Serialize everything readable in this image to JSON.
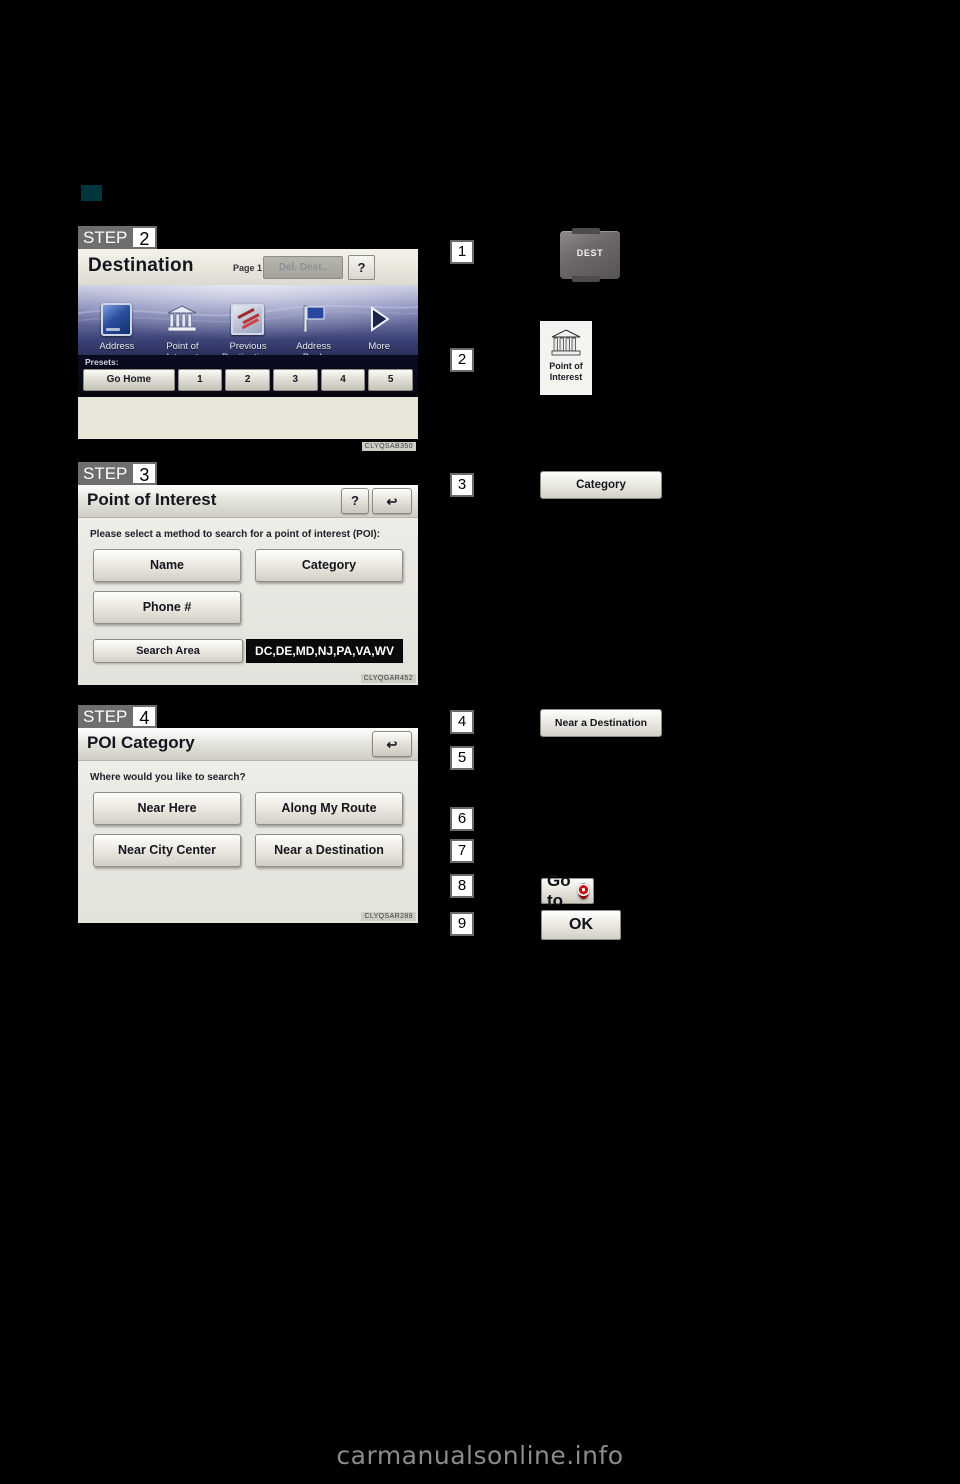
{
  "page": {
    "watermark": "carmanualsonline.info"
  },
  "steps": [
    {
      "badge_word": "STEP",
      "badge_num": "2",
      "screen": "destination",
      "title": "Destination",
      "page_label": "Page 1",
      "del_dest_label": "Del. Dest..",
      "help_label": "?",
      "icons": [
        {
          "label": "Address",
          "icon": "address-icon"
        },
        {
          "label": "Point of\nInterest",
          "line1": "Point of",
          "line2": "Interest",
          "icon": "point-of-interest-icon"
        },
        {
          "label": "Previous\nDestinations",
          "line1": "Previous",
          "line2": "Destinations",
          "icon": "previous-destinations-icon"
        },
        {
          "label": "Address\nBook",
          "line1": "Address",
          "line2": "Book",
          "icon": "address-book-flag-icon"
        },
        {
          "label": "More",
          "line1": "More",
          "line2": "",
          "icon": "more-arrow-icon"
        }
      ],
      "presets_label": "Presets:",
      "presets": [
        "Go Home",
        "1",
        "2",
        "3",
        "4",
        "5"
      ],
      "figure_code": "CLYQSAB350"
    },
    {
      "badge_word": "STEP",
      "badge_num": "3",
      "screen": "point-of-interest",
      "title": "Point of Interest",
      "help_label": "?",
      "back_label": "↩",
      "prompt": "Please select a method to search for a point of interest (POI):",
      "buttons": [
        "Name",
        "Category",
        "Phone #"
      ],
      "search_area_label": "Search Area",
      "search_area_value": "DC,DE,MD,NJ,PA,VA,WV",
      "figure_code": "CLYQGAR452"
    },
    {
      "badge_word": "STEP",
      "badge_num": "4",
      "screen": "poi-category",
      "title": "POI Category",
      "back_label": "↩",
      "prompt": "Where would you like to search?",
      "buttons": [
        "Near Here",
        "Along My Route",
        "Near City Center",
        "Near a Destination"
      ],
      "figure_code": "CLYQSAR288"
    }
  ],
  "callouts": [
    {
      "num": "1",
      "art": "dest-hardware-key",
      "label": "DEST"
    },
    {
      "num": "2",
      "art": "poi-tile",
      "label_line1": "Point of",
      "label_line2": "Interest"
    },
    {
      "num": "3",
      "art": "button",
      "label": "Category"
    },
    {
      "num": "4",
      "art": "button",
      "label": "Near a Destination"
    },
    {
      "num": "5",
      "art": "none",
      "label": ""
    },
    {
      "num": "6",
      "art": "none",
      "label": ""
    },
    {
      "num": "7",
      "art": "none",
      "label": ""
    },
    {
      "num": "8",
      "art": "goto-button",
      "label": "Go to"
    },
    {
      "num": "9",
      "art": "ok-button",
      "label": "OK"
    }
  ],
  "colors": {
    "section_marker": "#00353d",
    "step_badge_grey": "#6e6e6e",
    "target_red": "#c3121b",
    "screen_cream": "#eceadd"
  }
}
